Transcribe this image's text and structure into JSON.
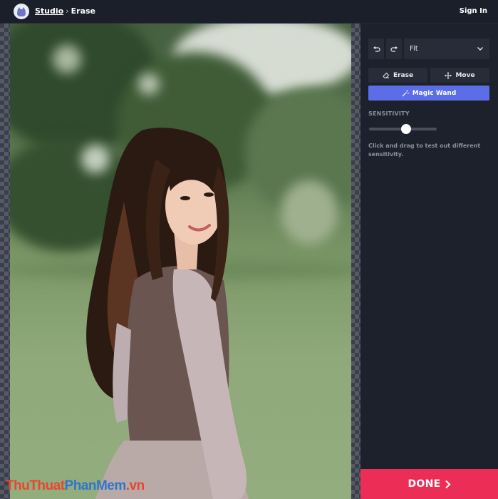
{
  "header": {
    "breadcrumb_app": "Studio",
    "breadcrumb_sep": "›",
    "breadcrumb_page": "Erase",
    "signin_label": "Sign In"
  },
  "icons": {
    "logo": "cat-avatar-icon",
    "undo": "undo-icon",
    "redo": "redo-icon",
    "dropdown": "chevron-down-icon",
    "erase": "eraser-icon",
    "move": "move-arrows-icon",
    "magic_wand": "magic-wand-icon",
    "done": "chevron-right-icon"
  },
  "toolbar": {
    "zoom_value": "Fit",
    "erase_label": "Erase",
    "move_label": "Move",
    "magic_wand_label": "Magic Wand"
  },
  "sensitivity": {
    "label": "SENSITIVITY",
    "value_fraction": 0.55,
    "hint": "Click and drag to test out different sensitivity."
  },
  "done_label": "DONE",
  "watermark": {
    "part1": "ThuThuat",
    "part2": "PhanMem",
    "part3": ".vn"
  },
  "colors": {
    "accent": "#5b6ee8",
    "done": "#ec2d55",
    "panel": "#1d212c"
  }
}
